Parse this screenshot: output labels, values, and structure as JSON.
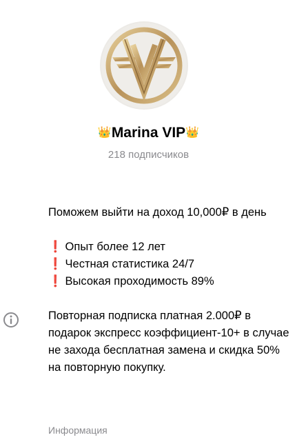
{
  "channel": {
    "title": "Marina VIP",
    "title_prefix_emoji": "👑",
    "title_suffix_emoji": "👑",
    "subscribers": "218 подписчиков",
    "avatar_icon": "golden-v-logo-icon"
  },
  "description": {
    "intro": "Поможем выйти на доход  10,000₽ в день",
    "features": [
      {
        "mark": "❗",
        "text": "Опыт более 12 лет"
      },
      {
        "mark": "❗",
        "text": "Честная статистика 24/7"
      },
      {
        "mark": "❗",
        "text": "Высокая проходимость 89%"
      }
    ],
    "paragraph": "Повторная подписка платная 2.000₽ в подарок  экспресс коэффициент-10+ в случае не захода бесплатная замена и скидка 50% на повторную покупку."
  },
  "info": {
    "icon": "info-icon",
    "caption": "Информация"
  },
  "colors": {
    "accent_red": "#e0302a",
    "secondary_text": "#8a8a8e",
    "gold": "#c4a468"
  }
}
